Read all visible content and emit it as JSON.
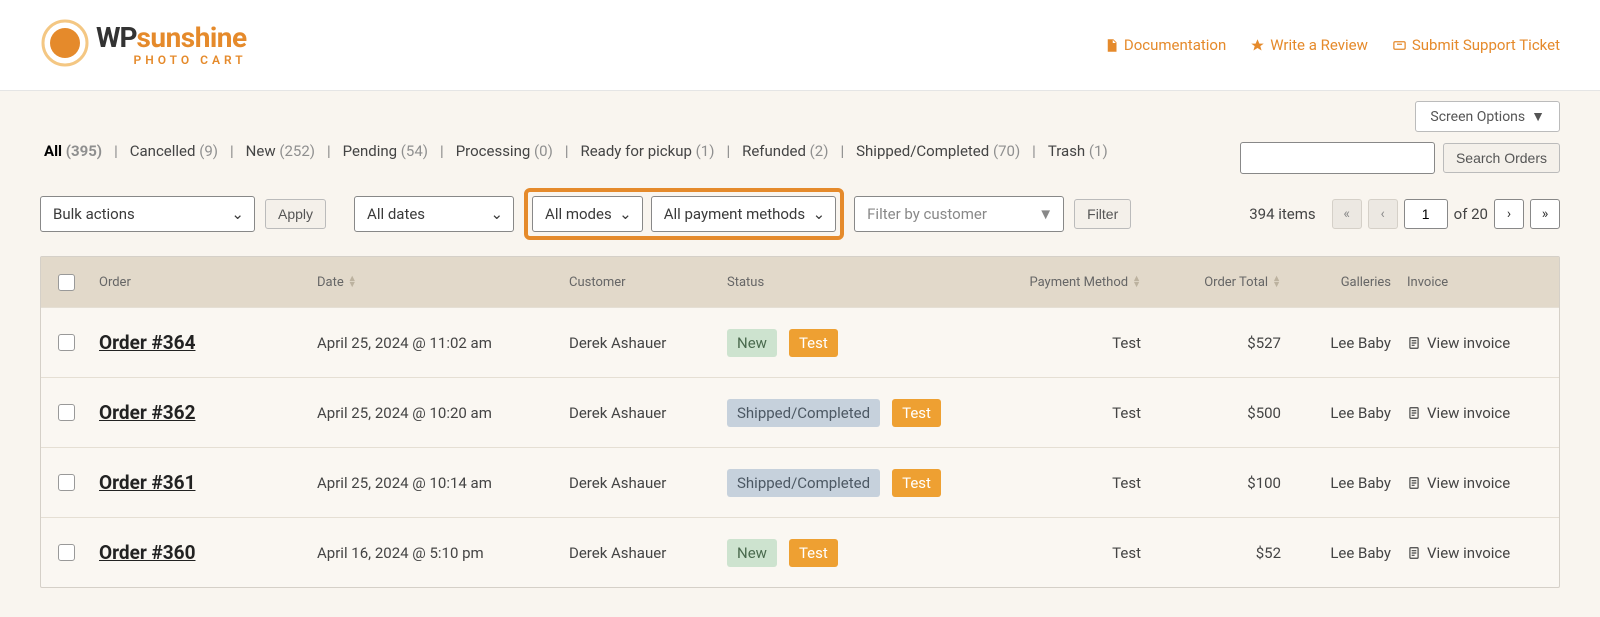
{
  "brand": {
    "wp": "WP",
    "sun": "sunshine",
    "sub": "PHOTO CART"
  },
  "top_links": {
    "docs": "Documentation",
    "review": "Write a Review",
    "support": "Submit Support Ticket"
  },
  "screen_options": "Screen Options",
  "status_filters": [
    {
      "label": "All",
      "count": "(395)",
      "current": true
    },
    {
      "label": "Cancelled",
      "count": "(9)"
    },
    {
      "label": "New",
      "count": "(252)"
    },
    {
      "label": "Pending",
      "count": "(54)"
    },
    {
      "label": "Processing",
      "count": "(0)"
    },
    {
      "label": "Ready for pickup",
      "count": "(1)"
    },
    {
      "label": "Refunded",
      "count": "(2)"
    },
    {
      "label": "Shipped/Completed",
      "count": "(70)"
    },
    {
      "label": "Trash",
      "count": "(1)"
    }
  ],
  "search_button": "Search Orders",
  "bulk": {
    "actions": "Bulk actions",
    "apply": "Apply"
  },
  "filters": {
    "dates": "All dates",
    "modes": "All modes",
    "payment": "All payment methods",
    "customer_placeholder": "Filter by customer",
    "filter_btn": "Filter"
  },
  "pager": {
    "items": "394 items",
    "current": "1",
    "of": "of 20"
  },
  "columns": {
    "order": "Order",
    "date": "Date",
    "customer": "Customer",
    "status": "Status",
    "method": "Payment Method",
    "total": "Order Total",
    "galleries": "Galleries",
    "invoice": "Invoice"
  },
  "view_invoice": "View invoice",
  "rows": [
    {
      "order": "Order #364",
      "date": "April 25, 2024 @ 11:02 am",
      "customer": "Derek Ashauer",
      "status": "New",
      "status_type": "new",
      "test": "Test",
      "method": "Test",
      "total": "$527",
      "gallery": "Lee Baby"
    },
    {
      "order": "Order #362",
      "date": "April 25, 2024 @ 10:20 am",
      "customer": "Derek Ashauer",
      "status": "Shipped/Completed",
      "status_type": "shipped",
      "test": "Test",
      "method": "Test",
      "total": "$500",
      "gallery": "Lee Baby"
    },
    {
      "order": "Order #361",
      "date": "April 25, 2024 @ 10:14 am",
      "customer": "Derek Ashauer",
      "status": "Shipped/Completed",
      "status_type": "shipped",
      "test": "Test",
      "method": "Test",
      "total": "$100",
      "gallery": "Lee Baby"
    },
    {
      "order": "Order #360",
      "date": "April 16, 2024 @ 5:10 pm",
      "customer": "Derek Ashauer",
      "status": "New",
      "status_type": "new",
      "test": "Test",
      "method": "Test",
      "total": "$52",
      "gallery": "Lee Baby"
    }
  ]
}
